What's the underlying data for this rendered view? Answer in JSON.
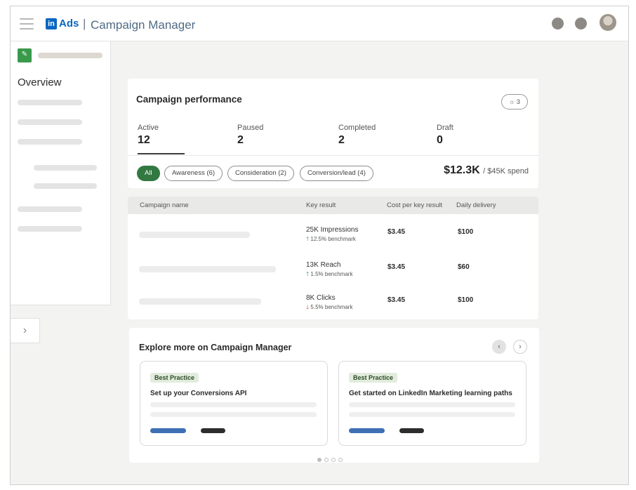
{
  "header": {
    "logo_in": "in",
    "logo_ads": "Ads",
    "separator": "|",
    "title": "Campaign Manager"
  },
  "sidebar": {
    "overview": "Overview",
    "collapse_icon": "chevron-right-icon"
  },
  "performance": {
    "title": "Campaign performance",
    "insights_count": "3",
    "stats": [
      {
        "label": "Active",
        "value": "12"
      },
      {
        "label": "Paused",
        "value": "2"
      },
      {
        "label": "Completed",
        "value": "2"
      },
      {
        "label": "Draft",
        "value": "0"
      }
    ],
    "filters": [
      "All",
      "Awareness (6)",
      "Consideration (2)",
      "Conversion/lead (4)"
    ],
    "spend_value": "$12.3K",
    "spend_total": "/ $45K spend"
  },
  "table": {
    "headers": [
      "Campaign name",
      "Key result",
      "Cost per key result",
      "Daily delivery"
    ],
    "rows": [
      {
        "key_result": "25K Impressions",
        "benchmark": "12.5% benchmark",
        "trend": "up",
        "cost": "$3.45",
        "daily": "$100"
      },
      {
        "key_result": "13K Reach",
        "benchmark": "1.5% benchmark",
        "trend": "up",
        "cost": "$3.45",
        "daily": "$60"
      },
      {
        "key_result": "8K Clicks",
        "benchmark": "5.5% benchmark",
        "trend": "down",
        "cost": "$3.45",
        "daily": "$100"
      }
    ]
  },
  "explore": {
    "title": "Explore more on Campaign Manager",
    "cards": [
      {
        "badge": "Best Practice",
        "title": "Set up your Conversions API"
      },
      {
        "badge": "Best Practice",
        "title": "Get started on LinkedIn Marketing learning paths"
      }
    ]
  },
  "colors": {
    "brand_blue": "#0a66c2",
    "accent_green": "#327841",
    "up": "#2e7d3a",
    "down": "#c0392b",
    "primary_bar": "#3f6fb5",
    "secondary_bar": "#2d2d2d"
  }
}
